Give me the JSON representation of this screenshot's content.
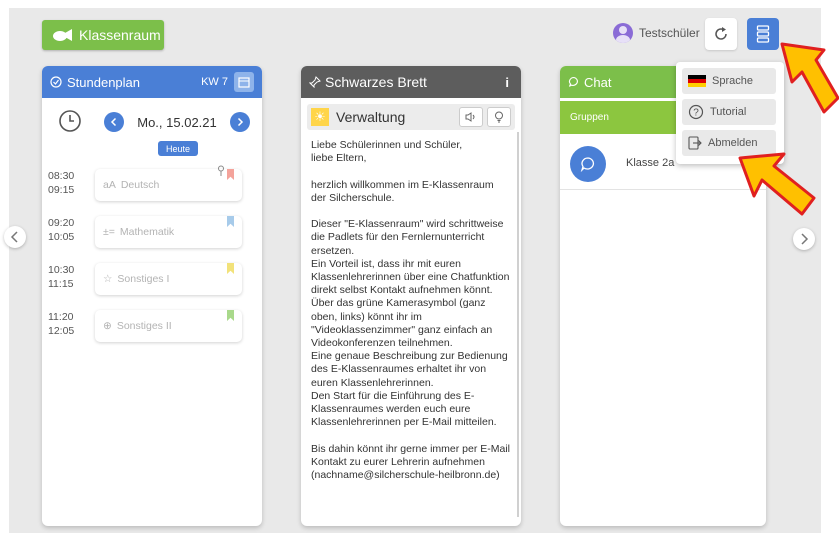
{
  "app": {
    "brand_label": "Klassenraum"
  },
  "header": {
    "user_name": "Testschüler"
  },
  "menu": {
    "items": [
      {
        "label": "Sprache",
        "icon": "german-flag-icon"
      },
      {
        "label": "Tutorial",
        "icon": "question-icon"
      },
      {
        "label": "Abmelden",
        "icon": "logout-icon"
      }
    ]
  },
  "schedule": {
    "title": "Stundenplan",
    "week": "KW 7",
    "date": "Mo., 15.02.21",
    "today_label": "Heute",
    "slots": [
      {
        "start": "08:30",
        "end": "09:15",
        "subject": "Deutsch",
        "icon_text": "aA",
        "bookmark_color": "#f4a39b"
      },
      {
        "start": "09:20",
        "end": "10:05",
        "subject": "Mathematik",
        "icon_text": "±=",
        "bookmark_color": "#a7cbea"
      },
      {
        "start": "10:30",
        "end": "11:15",
        "subject": "Sonstiges I",
        "icon_text": "☆",
        "bookmark_color": "#f2e27a"
      },
      {
        "start": "11:20",
        "end": "12:05",
        "subject": "Sonstiges II",
        "icon_text": "⊕",
        "bookmark_color": "#a9d98b"
      }
    ]
  },
  "board": {
    "title": "Schwarzes Brett",
    "info_label": "i",
    "section_title": "Verwaltung",
    "text": "Liebe Schülerinnen und Schüler,\nliebe Eltern,\n\nherzlich willkommen im E-Klassenraum\nder Silcherschule.\n\nDieser \"E-Klassenraum\" wird schrittweise\ndie Padlets für den Fernlernunterricht\nersetzen.\nEin Vorteil ist, dass ihr mit euren\nKlassenlehrerinnen über eine Chatfunktion\ndirekt selbst Kontakt aufnehmen könnt.\nÜber das grüne Kamerasymbol (ganz\noben, links) könnt ihr im\n\"Videoklassenzimmer\" ganz einfach an\nVideokonferenzen teilnehmen.\nEine genaue Beschreibung zur Bedienung\ndes E-Klassenraumes erhaltet ihr von\neuren Klassenlehrerinnen.\nDen Start für die Einführung des E-\nKlassenraumes werden euch eure\nKlassenlehrerinnen per E-Mail mitteilen.\n\nBis dahin könnt ihr gerne immer per E-Mail\nKontakt zu eurer Lehrerin aufnehmen\n(nachname@silcherschule-heilbronn.de)"
  },
  "chat": {
    "title": "Chat",
    "tab_label": "Gruppen",
    "groups": [
      {
        "name": "Klasse 2a"
      }
    ]
  },
  "colors": {
    "brand_green": "#7cbf4a",
    "schedule_blue": "#4a7fd6",
    "board_gray": "#5d5d5d",
    "arrow_orange": "#ffc000",
    "arrow_red": "#e02020"
  }
}
